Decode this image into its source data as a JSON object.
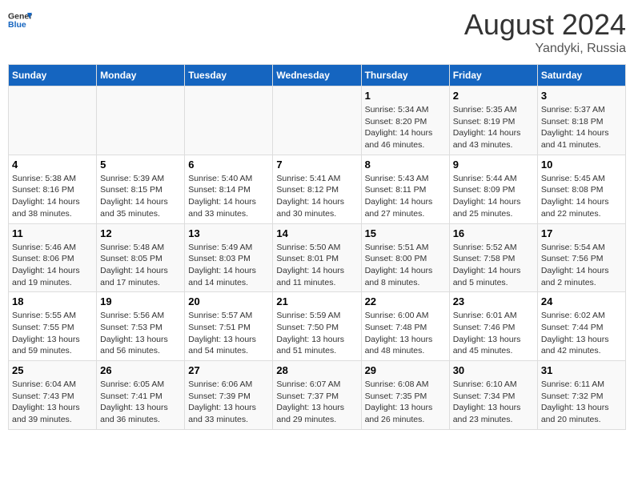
{
  "header": {
    "logo_general": "General",
    "logo_blue": "Blue",
    "month_year": "August 2024",
    "location": "Yandyki, Russia"
  },
  "weekdays": [
    "Sunday",
    "Monday",
    "Tuesday",
    "Wednesday",
    "Thursday",
    "Friday",
    "Saturday"
  ],
  "weeks": [
    {
      "days": [
        {
          "num": "",
          "info": ""
        },
        {
          "num": "",
          "info": ""
        },
        {
          "num": "",
          "info": ""
        },
        {
          "num": "",
          "info": ""
        },
        {
          "num": "1",
          "info": "Sunrise: 5:34 AM\nSunset: 8:20 PM\nDaylight: 14 hours\nand 46 minutes."
        },
        {
          "num": "2",
          "info": "Sunrise: 5:35 AM\nSunset: 8:19 PM\nDaylight: 14 hours\nand 43 minutes."
        },
        {
          "num": "3",
          "info": "Sunrise: 5:37 AM\nSunset: 8:18 PM\nDaylight: 14 hours\nand 41 minutes."
        }
      ]
    },
    {
      "days": [
        {
          "num": "4",
          "info": "Sunrise: 5:38 AM\nSunset: 8:16 PM\nDaylight: 14 hours\nand 38 minutes."
        },
        {
          "num": "5",
          "info": "Sunrise: 5:39 AM\nSunset: 8:15 PM\nDaylight: 14 hours\nand 35 minutes."
        },
        {
          "num": "6",
          "info": "Sunrise: 5:40 AM\nSunset: 8:14 PM\nDaylight: 14 hours\nand 33 minutes."
        },
        {
          "num": "7",
          "info": "Sunrise: 5:41 AM\nSunset: 8:12 PM\nDaylight: 14 hours\nand 30 minutes."
        },
        {
          "num": "8",
          "info": "Sunrise: 5:43 AM\nSunset: 8:11 PM\nDaylight: 14 hours\nand 27 minutes."
        },
        {
          "num": "9",
          "info": "Sunrise: 5:44 AM\nSunset: 8:09 PM\nDaylight: 14 hours\nand 25 minutes."
        },
        {
          "num": "10",
          "info": "Sunrise: 5:45 AM\nSunset: 8:08 PM\nDaylight: 14 hours\nand 22 minutes."
        }
      ]
    },
    {
      "days": [
        {
          "num": "11",
          "info": "Sunrise: 5:46 AM\nSunset: 8:06 PM\nDaylight: 14 hours\nand 19 minutes."
        },
        {
          "num": "12",
          "info": "Sunrise: 5:48 AM\nSunset: 8:05 PM\nDaylight: 14 hours\nand 17 minutes."
        },
        {
          "num": "13",
          "info": "Sunrise: 5:49 AM\nSunset: 8:03 PM\nDaylight: 14 hours\nand 14 minutes."
        },
        {
          "num": "14",
          "info": "Sunrise: 5:50 AM\nSunset: 8:01 PM\nDaylight: 14 hours\nand 11 minutes."
        },
        {
          "num": "15",
          "info": "Sunrise: 5:51 AM\nSunset: 8:00 PM\nDaylight: 14 hours\nand 8 minutes."
        },
        {
          "num": "16",
          "info": "Sunrise: 5:52 AM\nSunset: 7:58 PM\nDaylight: 14 hours\nand 5 minutes."
        },
        {
          "num": "17",
          "info": "Sunrise: 5:54 AM\nSunset: 7:56 PM\nDaylight: 14 hours\nand 2 minutes."
        }
      ]
    },
    {
      "days": [
        {
          "num": "18",
          "info": "Sunrise: 5:55 AM\nSunset: 7:55 PM\nDaylight: 13 hours\nand 59 minutes."
        },
        {
          "num": "19",
          "info": "Sunrise: 5:56 AM\nSunset: 7:53 PM\nDaylight: 13 hours\nand 56 minutes."
        },
        {
          "num": "20",
          "info": "Sunrise: 5:57 AM\nSunset: 7:51 PM\nDaylight: 13 hours\nand 54 minutes."
        },
        {
          "num": "21",
          "info": "Sunrise: 5:59 AM\nSunset: 7:50 PM\nDaylight: 13 hours\nand 51 minutes."
        },
        {
          "num": "22",
          "info": "Sunrise: 6:00 AM\nSunset: 7:48 PM\nDaylight: 13 hours\nand 48 minutes."
        },
        {
          "num": "23",
          "info": "Sunrise: 6:01 AM\nSunset: 7:46 PM\nDaylight: 13 hours\nand 45 minutes."
        },
        {
          "num": "24",
          "info": "Sunrise: 6:02 AM\nSunset: 7:44 PM\nDaylight: 13 hours\nand 42 minutes."
        }
      ]
    },
    {
      "days": [
        {
          "num": "25",
          "info": "Sunrise: 6:04 AM\nSunset: 7:43 PM\nDaylight: 13 hours\nand 39 minutes."
        },
        {
          "num": "26",
          "info": "Sunrise: 6:05 AM\nSunset: 7:41 PM\nDaylight: 13 hours\nand 36 minutes."
        },
        {
          "num": "27",
          "info": "Sunrise: 6:06 AM\nSunset: 7:39 PM\nDaylight: 13 hours\nand 33 minutes."
        },
        {
          "num": "28",
          "info": "Sunrise: 6:07 AM\nSunset: 7:37 PM\nDaylight: 13 hours\nand 29 minutes."
        },
        {
          "num": "29",
          "info": "Sunrise: 6:08 AM\nSunset: 7:35 PM\nDaylight: 13 hours\nand 26 minutes."
        },
        {
          "num": "30",
          "info": "Sunrise: 6:10 AM\nSunset: 7:34 PM\nDaylight: 13 hours\nand 23 minutes."
        },
        {
          "num": "31",
          "info": "Sunrise: 6:11 AM\nSunset: 7:32 PM\nDaylight: 13 hours\nand 20 minutes."
        }
      ]
    }
  ]
}
